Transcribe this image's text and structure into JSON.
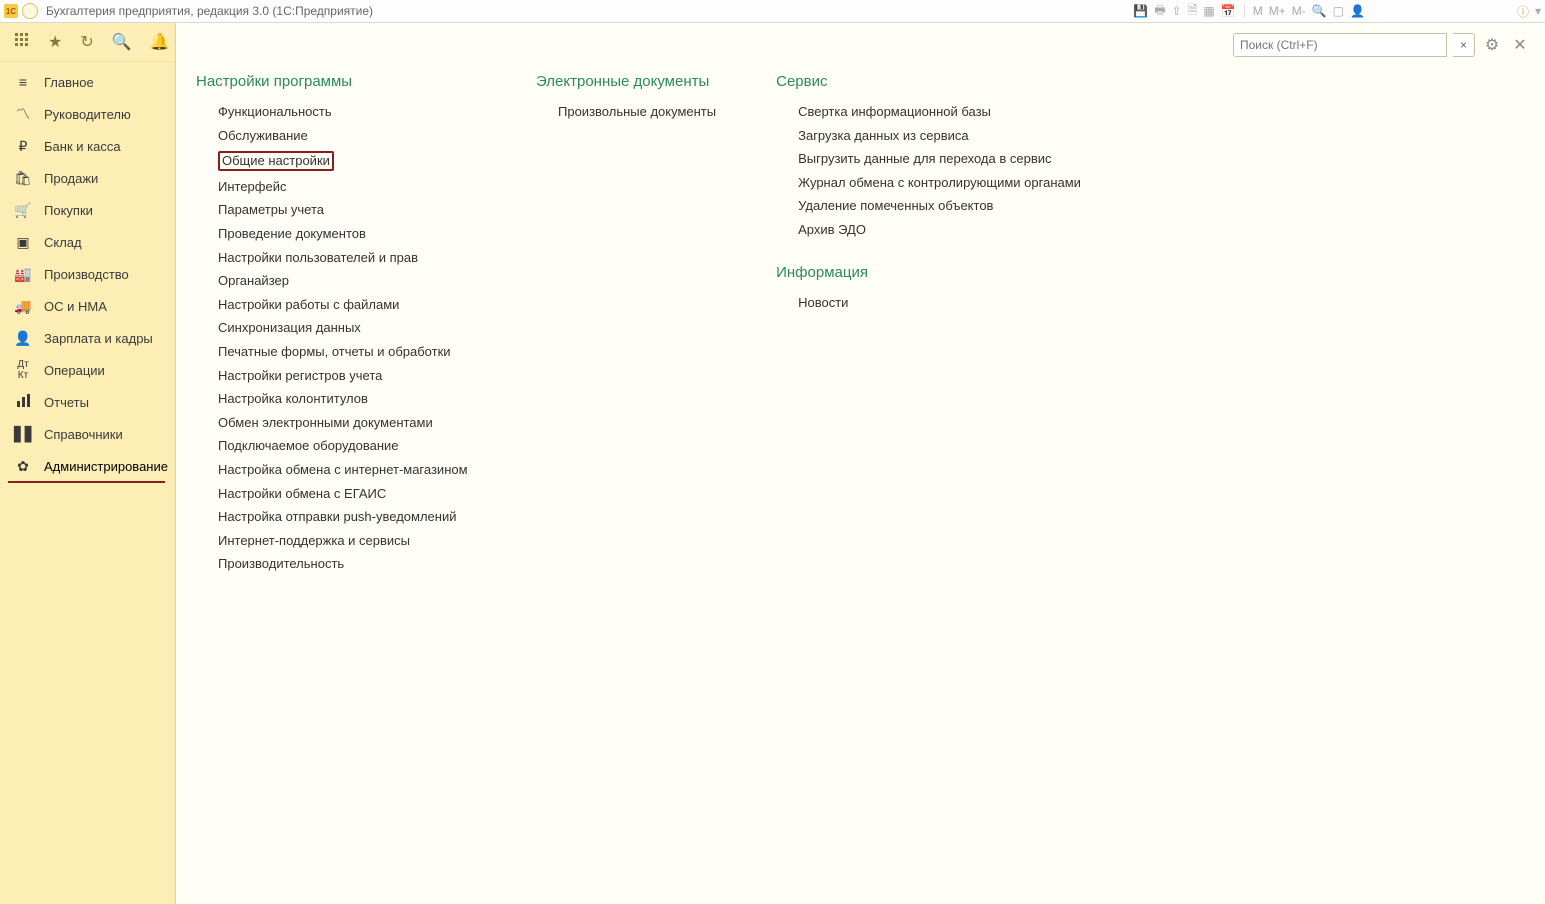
{
  "title": "Бухгалтерия предприятия, редакция 3.0   (1С:Предприятие)",
  "search": {
    "placeholder": "Поиск (Ctrl+F)"
  },
  "toolbar_letters": {
    "m": "M",
    "mplus": "M+",
    "mminus": "M-"
  },
  "sidebar": {
    "items": [
      {
        "label": "Главное",
        "icon": "menu"
      },
      {
        "label": "Руководителю",
        "icon": "chart"
      },
      {
        "label": "Банк и касса",
        "icon": "ruble"
      },
      {
        "label": "Продажи",
        "icon": "cart"
      },
      {
        "label": "Покупки",
        "icon": "basket"
      },
      {
        "label": "Склад",
        "icon": "boxes"
      },
      {
        "label": "Производство",
        "icon": "factory"
      },
      {
        "label": "ОС и НМА",
        "icon": "truck"
      },
      {
        "label": "Зарплата и кадры",
        "icon": "person"
      },
      {
        "label": "Операции",
        "icon": "ops"
      },
      {
        "label": "Отчеты",
        "icon": "bars"
      },
      {
        "label": "Справочники",
        "icon": "books"
      },
      {
        "label": "Администрирование",
        "icon": "gear"
      }
    ]
  },
  "columns": {
    "settings": {
      "title": "Настройки программы",
      "links": [
        "Функциональность",
        "Обслуживание",
        "Общие настройки",
        "Интерфейс",
        "Параметры учета",
        "Проведение документов",
        "Настройки пользователей и прав",
        "Органайзер",
        "Настройки работы с файлами",
        "Синхронизация данных",
        "Печатные формы, отчеты и обработки",
        "Настройки регистров учета",
        "Настройка колонтитулов",
        "Обмен электронными документами",
        "Подключаемое оборудование",
        "Настройка обмена с интернет-магазином",
        "Настройки обмена с ЕГАИС",
        "Настройка отправки push-уведомлений",
        "Интернет-поддержка и сервисы",
        "Производительность"
      ]
    },
    "edocs": {
      "title": "Электронные документы",
      "links": [
        "Произвольные документы"
      ]
    },
    "service": {
      "title": "Сервис",
      "links": [
        "Свертка информационной базы",
        "Загрузка данных из сервиса",
        "Выгрузить данные для перехода в сервис",
        "Журнал обмена с контролирующими органами",
        "Удаление помеченных объектов",
        "Архив ЭДО"
      ]
    },
    "info": {
      "title": "Информация",
      "links": [
        "Новости"
      ]
    }
  }
}
